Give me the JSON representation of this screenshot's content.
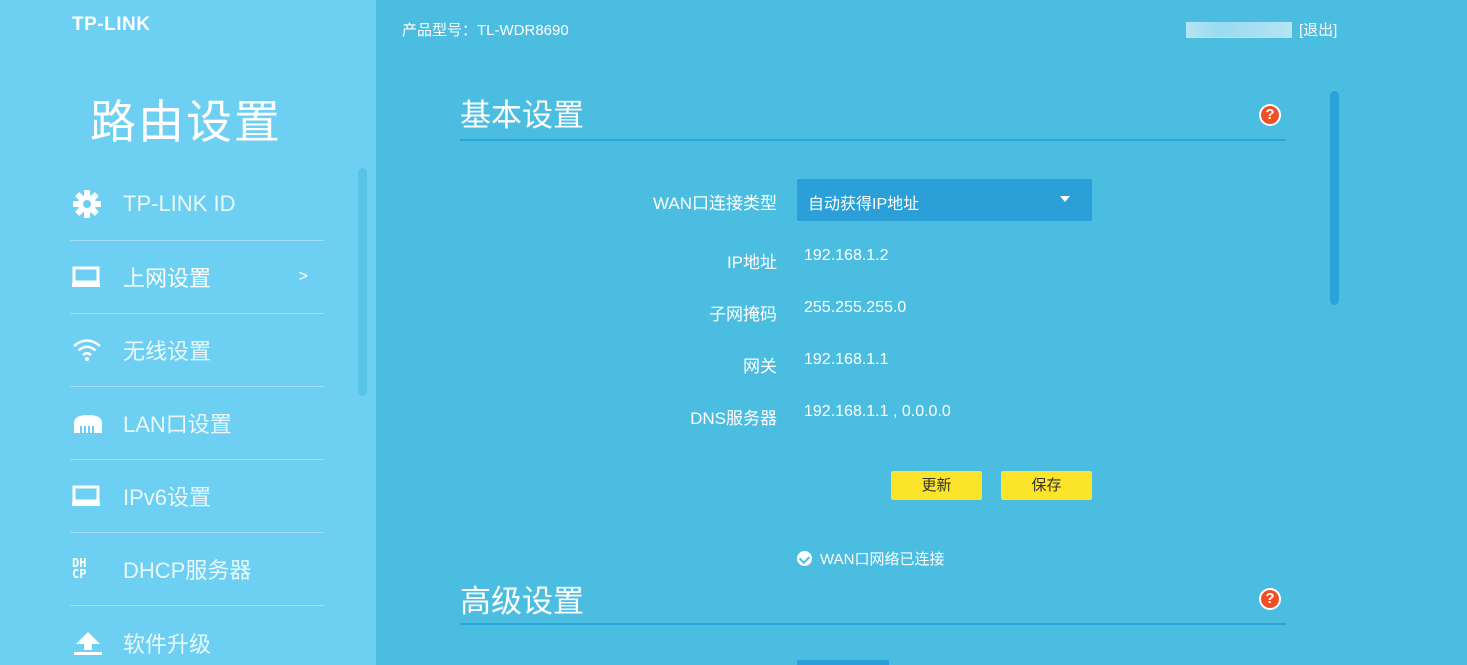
{
  "brand": {
    "logo": "TP-LINK"
  },
  "sidebar": {
    "title": "路由设置",
    "items": [
      {
        "label": "TP-LINK ID",
        "icon": "gear-icon"
      },
      {
        "label": "上网设置",
        "icon": "monitor-icon",
        "active": true,
        "arrow": ">"
      },
      {
        "label": "无线设置",
        "icon": "wifi-icon"
      },
      {
        "label": "LAN口设置",
        "icon": "lan-port-icon"
      },
      {
        "label": "IPv6设置",
        "icon": "monitor-icon"
      },
      {
        "label": "DHCP服务器",
        "icon": "dhcp-icon",
        "icon_text_top": "DH",
        "icon_text_bottom": "CP"
      },
      {
        "label": "软件升级",
        "icon": "upgrade-arrow-icon"
      }
    ]
  },
  "header": {
    "model": "产品型号：TL-WDR8690",
    "logout": "[退出]"
  },
  "basic": {
    "title": "基本设置",
    "help": "?",
    "wan_type_label": "WAN口连接类型",
    "wan_type_value": "自动获得IP地址",
    "fields": [
      {
        "label": "IP地址",
        "value": "192.168.1.2"
      },
      {
        "label": "子网掩码",
        "value": "255.255.255.0"
      },
      {
        "label": "网关",
        "value": "192.168.1.1"
      },
      {
        "label": "DNS服务器",
        "value": "192.168.1.1 , 0.0.0.0"
      }
    ],
    "refresh_label": "更新",
    "save_label": "保存",
    "status": "WAN口网络已连接"
  },
  "advanced": {
    "title": "高级设置",
    "help": "?"
  },
  "colors": {
    "sidebar_bg": "#6dd0f2",
    "main_bg": "#4bbde1",
    "accent": "#2a9fd8",
    "button": "#fbe42a",
    "help": "#f04e23"
  }
}
